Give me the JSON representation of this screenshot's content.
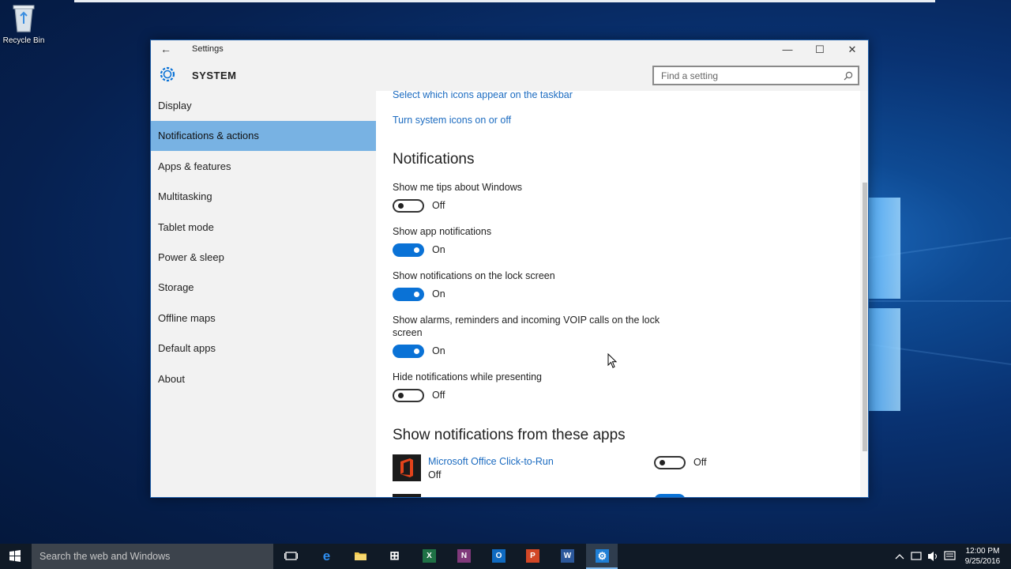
{
  "desktop": {
    "recycle_bin_label": "Recycle Bin"
  },
  "window": {
    "title": "Settings",
    "section": "SYSTEM",
    "search_placeholder": "Find a setting",
    "minimize_glyph": "—",
    "maximize_glyph": "☐",
    "close_glyph": "✕",
    "back_glyph": "←"
  },
  "sidebar": {
    "items": [
      {
        "label": "Display"
      },
      {
        "label": "Notifications & actions"
      },
      {
        "label": "Apps & features"
      },
      {
        "label": "Multitasking"
      },
      {
        "label": "Tablet mode"
      },
      {
        "label": "Power & sleep"
      },
      {
        "label": "Storage"
      },
      {
        "label": "Offline maps"
      },
      {
        "label": "Default apps"
      },
      {
        "label": "About"
      }
    ],
    "active_index": 1
  },
  "content": {
    "links": [
      "Select which icons appear on the taskbar",
      "Turn system icons on or off"
    ],
    "notifications_heading": "Notifications",
    "settings": [
      {
        "label": "Show me tips about Windows",
        "state": "Off"
      },
      {
        "label": "Show app notifications",
        "state": "On"
      },
      {
        "label": "Show notifications on the lock screen",
        "state": "On"
      },
      {
        "label": "Show alarms, reminders and incoming VOIP calls on the lock screen",
        "state": "On"
      },
      {
        "label": "Hide notifications while presenting",
        "state": "Off"
      }
    ],
    "apps_heading": "Show notifications from these apps",
    "apps": [
      {
        "name": "Microsoft Office Click-to-Run",
        "status": "Off",
        "toggle": "Off"
      }
    ]
  },
  "taskbar": {
    "search_placeholder": "Search the web and Windows",
    "pinned": [
      {
        "name": "task-view",
        "glyph": "▭"
      },
      {
        "name": "edge",
        "glyph": "e"
      },
      {
        "name": "file-explorer",
        "glyph": ""
      },
      {
        "name": "store",
        "glyph": "⊞"
      },
      {
        "name": "excel",
        "glyph": "X"
      },
      {
        "name": "onenote",
        "glyph": "N"
      },
      {
        "name": "outlook",
        "glyph": "O"
      },
      {
        "name": "powerpoint",
        "glyph": "P"
      },
      {
        "name": "word",
        "glyph": "W"
      },
      {
        "name": "settings",
        "glyph": "⚙"
      }
    ],
    "clock_time": "12:00 PM",
    "clock_date": "9/25/2016"
  },
  "colors": {
    "accent": "#0a72d6",
    "link": "#1b6bc0",
    "sidebar_active": "#78b2e3"
  }
}
